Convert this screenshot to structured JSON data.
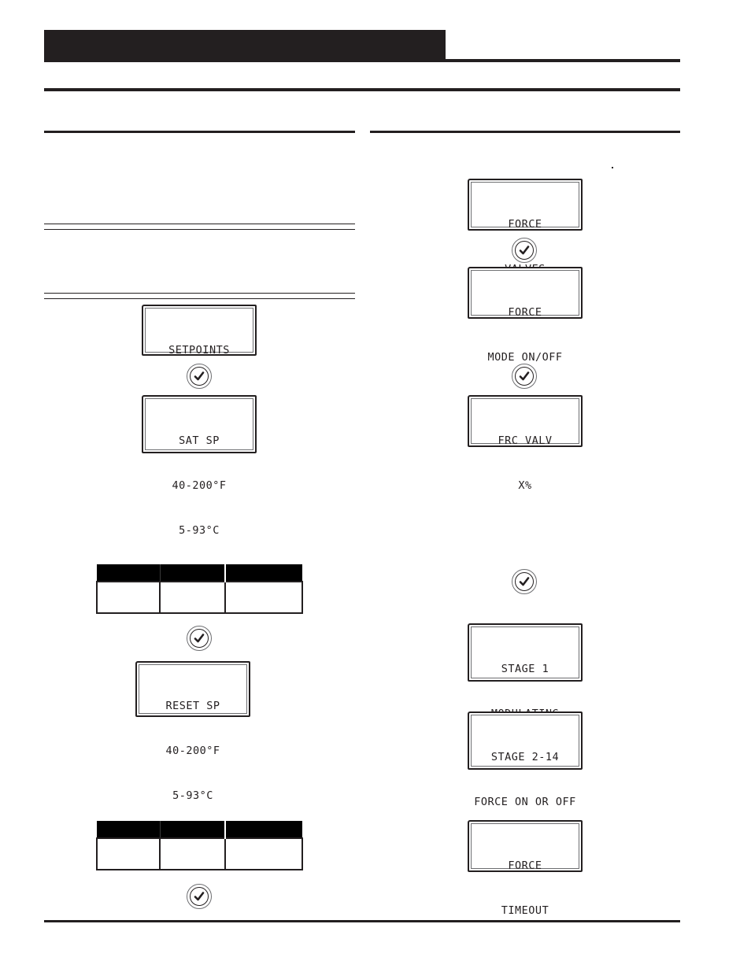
{
  "page": {
    "header_title": "",
    "section_heading": "",
    "footer_text": ""
  },
  "left_column": {
    "heading": "",
    "intro_text": "",
    "note_text": "",
    "displays": [
      {
        "id": "setpoints",
        "lines": [
          "SETPOINTS"
        ]
      },
      {
        "id": "sat-sp",
        "lines": [
          "SAT SP",
          "40-200°F",
          "5-93°C"
        ]
      },
      {
        "id": "reset-sp",
        "lines": [
          "RESET SP",
          "40-200°F",
          "5-93°C"
        ]
      }
    ],
    "tables": [
      {
        "headers": [
          "",
          "",
          ""
        ],
        "rows": [
          [
            "",
            "",
            ""
          ]
        ]
      },
      {
        "headers": [
          "",
          "",
          ""
        ],
        "rows": [
          [
            "",
            "",
            ""
          ]
        ]
      }
    ]
  },
  "right_column": {
    "heading": "",
    "displays": [
      {
        "id": "force-valves",
        "lines": [
          "FORCE",
          "VALVES"
        ]
      },
      {
        "id": "force-mode",
        "lines": [
          "FORCE",
          "MODE ON/OFF"
        ]
      },
      {
        "id": "frc-valv",
        "lines": [
          "FRC VALV",
          "X%"
        ]
      },
      {
        "id": "stage-1",
        "lines": [
          "STAGE 1",
          "MODULATING"
        ]
      },
      {
        "id": "stage-2-14",
        "lines": [
          "STAGE 2-14",
          "FORCE ON OR OFF"
        ]
      },
      {
        "id": "force-timeout",
        "lines": [
          "FORCE",
          "TIMEOUT"
        ]
      }
    ]
  },
  "icons": {
    "check_button": "check-circle-icon"
  },
  "colors": {
    "ink": "#231f20",
    "lcd_inner_border": "#6d6e71",
    "table_header": "#000000",
    "background": "#ffffff"
  }
}
